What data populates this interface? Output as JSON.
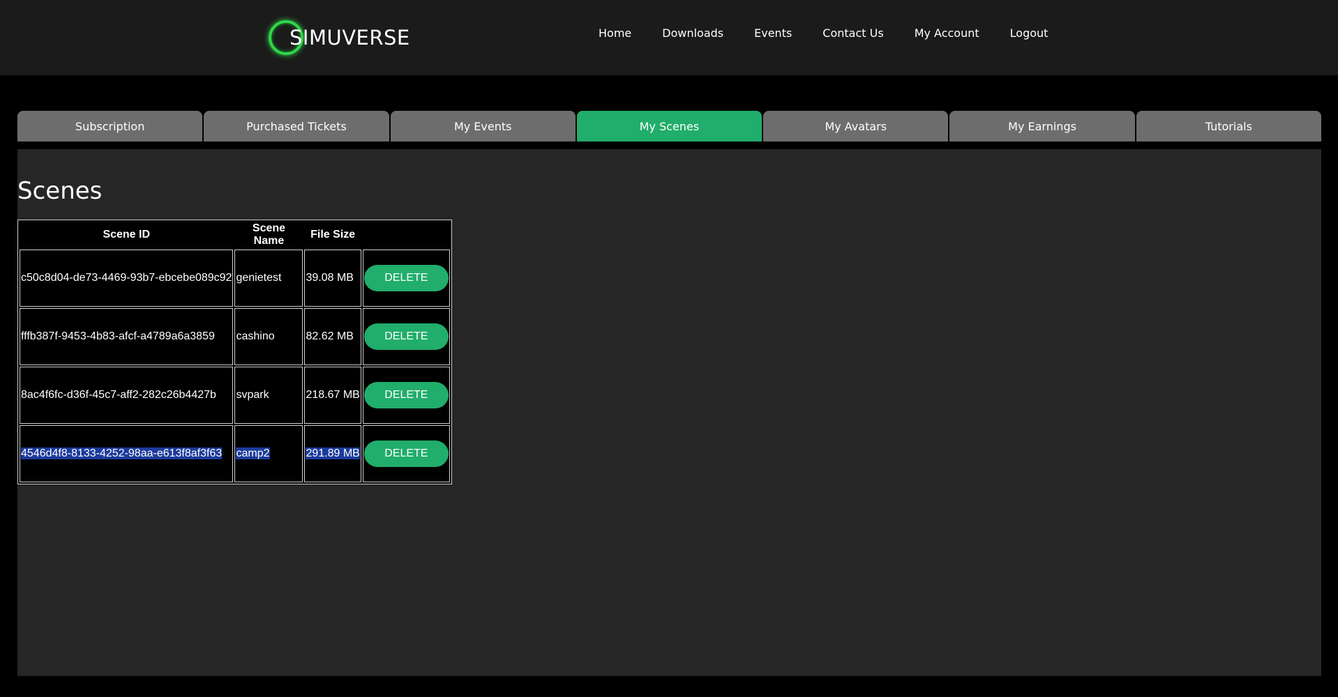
{
  "header": {
    "logo_text": "SIMUVERSE",
    "nav": [
      "Home",
      "Downloads",
      "Events",
      "Contact Us",
      "My Account",
      "Logout"
    ]
  },
  "tabs": [
    {
      "label": "Subscription",
      "active": false
    },
    {
      "label": "Purchased Tickets",
      "active": false
    },
    {
      "label": "My Events",
      "active": false
    },
    {
      "label": "My Scenes",
      "active": true
    },
    {
      "label": "My Avatars",
      "active": false
    },
    {
      "label": "My Earnings",
      "active": false
    },
    {
      "label": "Tutorials",
      "active": false
    }
  ],
  "main": {
    "title": "Scenes",
    "table": {
      "headers": [
        "Scene ID",
        "Scene Name",
        "File Size",
        ""
      ],
      "rows": [
        {
          "id": "c50c8d04-de73-4469-93b7-ebcebe089c92",
          "name": "genietest",
          "size": "39.08 MB",
          "action": "DELETE"
        },
        {
          "id": "fffb387f-9453-4b83-afcf-a4789a6a3859",
          "name": "cashino",
          "size": "82.62 MB",
          "action": "DELETE"
        },
        {
          "id": "8ac4f6fc-d36f-45c7-aff2-282c26b4427b",
          "name": "svpark",
          "size": "218.67 MB",
          "action": "DELETE"
        },
        {
          "id": "4546d4f8-8133-4252-98aa-e613f8af3f63",
          "name": "camp2",
          "size": "291.89 MB",
          "action": "DELETE"
        }
      ]
    }
  },
  "colors": {
    "accent": "#21ad6b",
    "tab_inactive": "#6d6d6d",
    "header_bg": "#1b1b1b",
    "panel_bg": "#262626",
    "selection": "#1c3b9c"
  }
}
